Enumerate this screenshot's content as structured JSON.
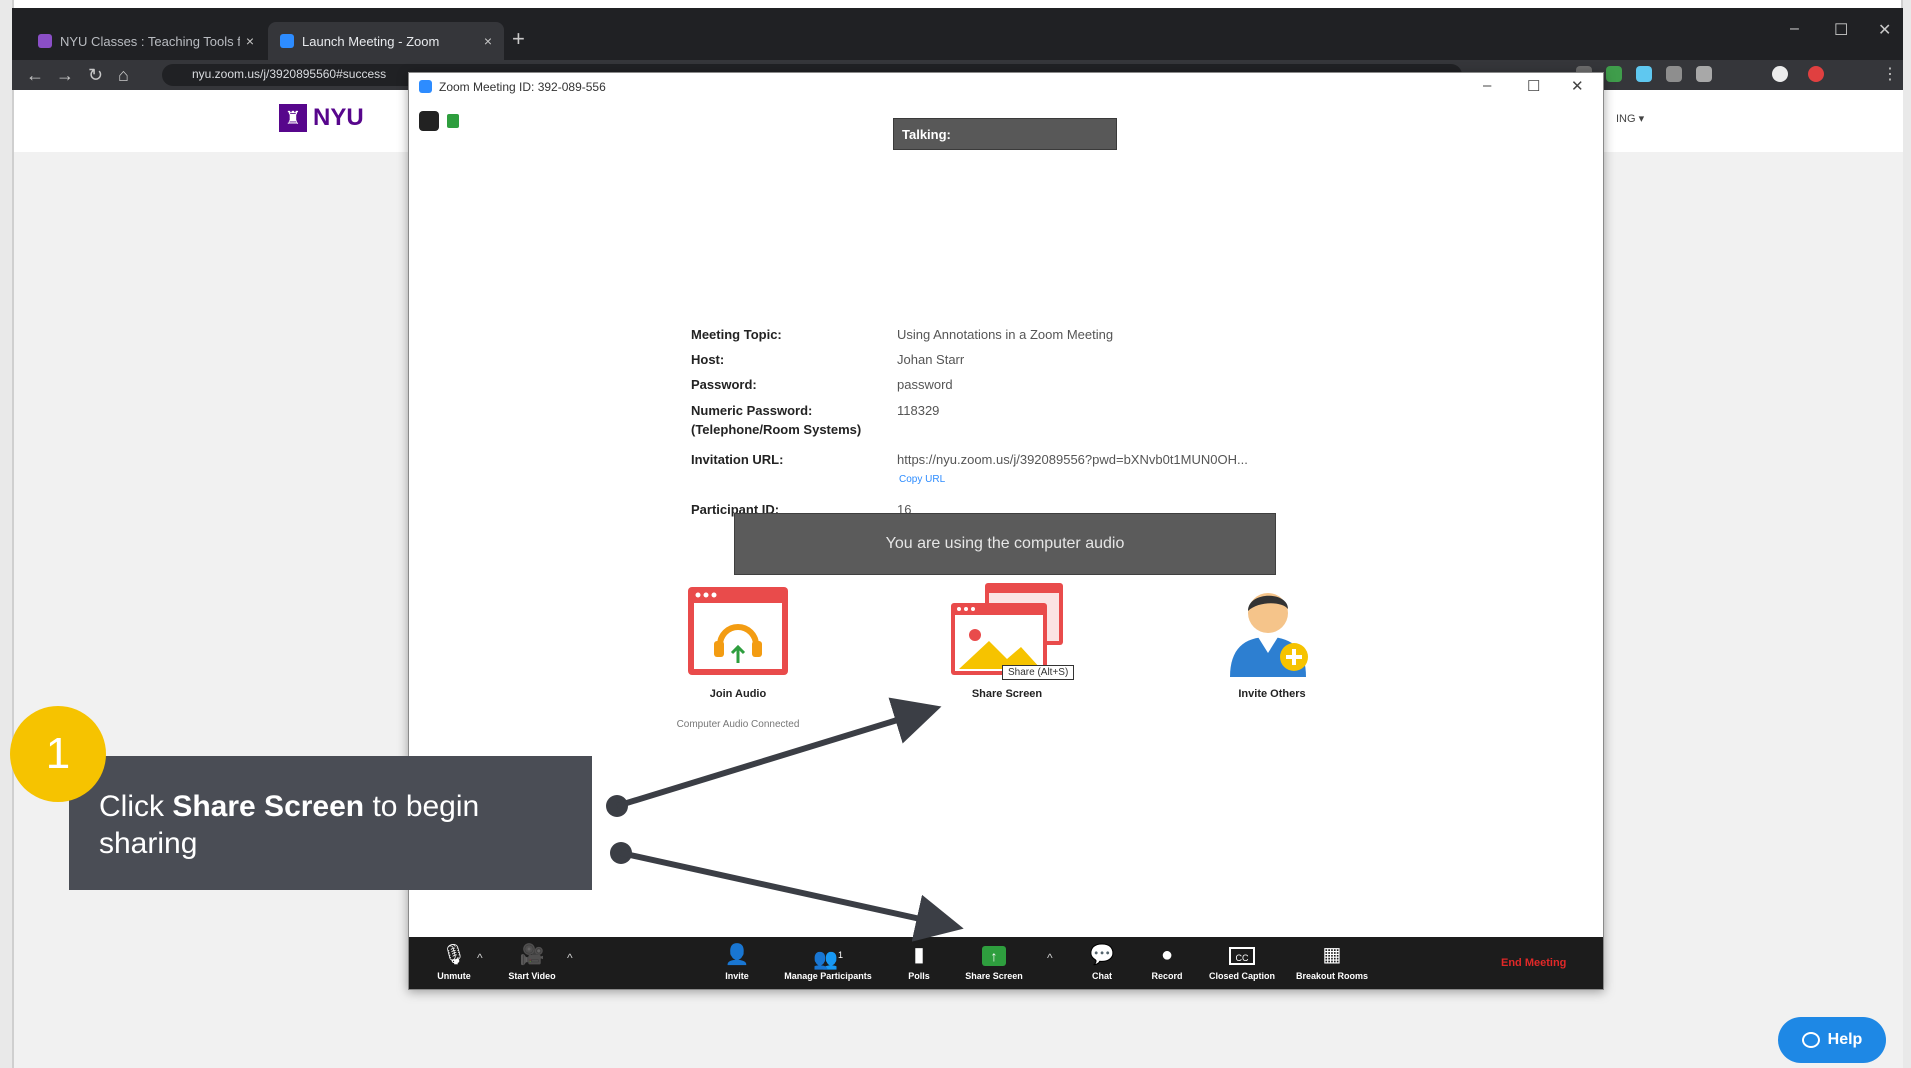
{
  "browser": {
    "tabs": [
      {
        "title": "NYU Classes : Teaching Tools for",
        "close": "×",
        "favicon_color": "#8b4fc7"
      },
      {
        "title": "Launch Meeting - Zoom",
        "close": "×",
        "favicon_color": "#2d8cff"
      }
    ],
    "new_tab": "+",
    "window_controls": {
      "minimize": "–",
      "maximize": "☐",
      "close": "✕"
    },
    "address": "nyu.zoom.us/j/3920895560#success"
  },
  "page": {
    "logo_text": "NYU",
    "account_menu": "ING ▾"
  },
  "zoom": {
    "window_title": "Zoom Meeting ID: 392-089-556",
    "window_controls": {
      "minimize": "–",
      "maximize": "☐",
      "close": "✕"
    },
    "talking_label": "Talking:",
    "meeting": {
      "topic_label": "Meeting Topic:",
      "topic_value": "Using Annotations in a Zoom Meeting",
      "host_label": "Host:",
      "host_value": "Johan Starr",
      "password_label": "Password:",
      "password_value": "password",
      "numeric_password_label": "Numeric Password:",
      "numeric_password_label2": "(Telephone/Room Systems)",
      "numeric_password_value": "118329",
      "invitation_label": "Invitation URL:",
      "invitation_value": "https://nyu.zoom.us/j/392089556?pwd=bXNvb0t1MUN0OH...",
      "copy_url": "Copy URL",
      "participant_label": "Participant ID:",
      "participant_value": "16"
    },
    "audio_toast": "You are using the computer audio",
    "options": {
      "join_audio": "Join Audio",
      "join_audio_sub": "Computer Audio Connected",
      "share_screen": "Share Screen",
      "share_tooltip": "Share (Alt+S)",
      "invite_others": "Invite Others"
    },
    "toolbar": {
      "unmute": "Unmute",
      "start_video": "Start Video",
      "invite": "Invite",
      "manage_participants": "Manage Participants",
      "participant_count": "1",
      "polls": "Polls",
      "share_screen": "Share Screen",
      "chat": "Chat",
      "record": "Record",
      "closed_caption": "Closed Caption",
      "breakout_rooms": "Breakout Rooms",
      "end_meeting": "End Meeting",
      "caret": "^"
    }
  },
  "callout": {
    "step_number": "1",
    "text_before": "Click ",
    "text_bold": "Share Screen",
    "text_after": " to begin sharing"
  },
  "help": {
    "label": "Help",
    "icon": "speech-bubble-icon"
  },
  "colors": {
    "nyu_purple": "#57068c",
    "zoom_blue": "#2d8cff",
    "callout_bg": "#4a4d55",
    "step_yellow": "#f6c300",
    "end_meeting_red": "#e02828",
    "help_blue": "#1e88e5"
  }
}
